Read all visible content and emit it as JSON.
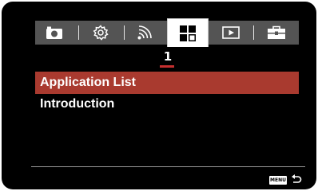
{
  "tabs": [
    {
      "name": "camera",
      "icon": "camera-icon",
      "active": false
    },
    {
      "name": "settings",
      "icon": "gear-icon",
      "active": false
    },
    {
      "name": "network",
      "icon": "wireless-icon",
      "active": false
    },
    {
      "name": "application",
      "icon": "app-grid-icon",
      "active": true
    },
    {
      "name": "playback",
      "icon": "play-icon",
      "active": false
    },
    {
      "name": "setup",
      "icon": "toolbox-icon",
      "active": false
    }
  ],
  "page": {
    "number": "1"
  },
  "menu": {
    "items": [
      {
        "label": "Application List",
        "selected": true
      },
      {
        "label": "Introduction",
        "selected": false
      }
    ]
  },
  "footer": {
    "menu_label": "MENU",
    "return_icon": "return-arrow-icon"
  },
  "colors": {
    "selection": "#a93a2f",
    "indicator": "#c62f2f",
    "tabbar": "#545454",
    "background": "#000000"
  }
}
